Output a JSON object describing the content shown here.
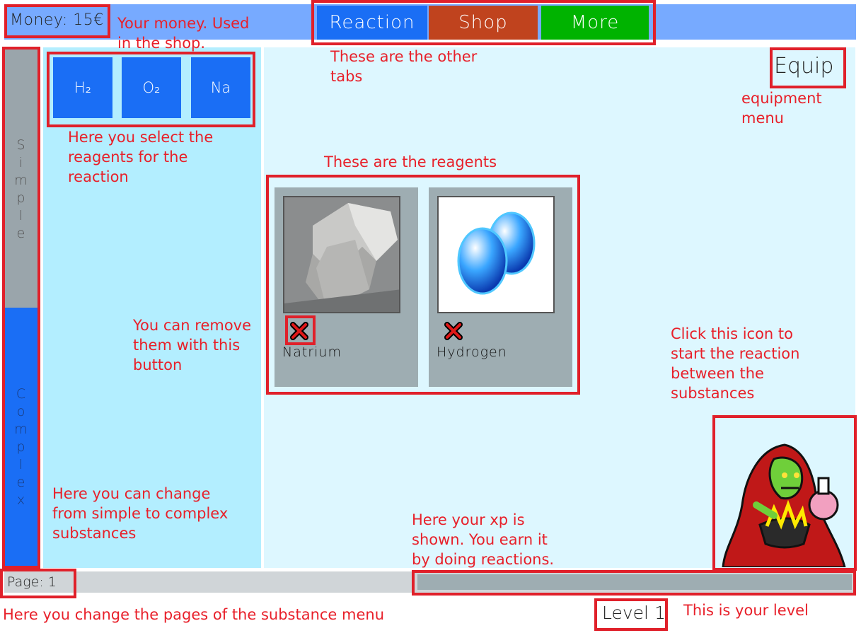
{
  "header": {
    "money": "Money: 15€",
    "tabs": [
      {
        "label": "Reaction",
        "color": "#1a6ef5"
      },
      {
        "label": "Shop",
        "color": "#c0431e"
      },
      {
        "label": "More",
        "color": "#00b300"
      }
    ]
  },
  "sidebar": {
    "simple": "S\ni\nm\np\nl\ne",
    "complex": "C\no\nm\np\nl\ne\nx"
  },
  "substances": [
    "H₂",
    "O₂",
    "Na"
  ],
  "equip_label": "Equip",
  "reagents": [
    {
      "name": "Natrium",
      "icon": "natrium-photo"
    },
    {
      "name": "Hydrogen",
      "icon": "hydrogen-bubbles"
    }
  ],
  "footer": {
    "page": "Page:  1",
    "level": "Level 1",
    "xp_fraction": 0
  },
  "annotations": {
    "money": "Your money. Used\nin the shop.",
    "tabs": "These are the other\ntabs",
    "equip": "equipment\nmenu",
    "select": "Here you select the\nreagents for the\nreaction",
    "reagents": "These are the reagents",
    "remove": "You can remove\nthem with this\nbutton",
    "start": "Click this icon to\nstart the reaction\nbetween the\nsubstances",
    "toggle": "Here you can change\nfrom simple to complex\nsubstances",
    "xp": "Here your xp is\nshown. You earn it\nby doing reactions.",
    "pages": "Here you change the pages of the substance menu",
    "level": "This is your level"
  },
  "colors": {
    "highlight": "#e0202a",
    "annotation": "#e8202a",
    "accent": "#1a6ef5"
  }
}
